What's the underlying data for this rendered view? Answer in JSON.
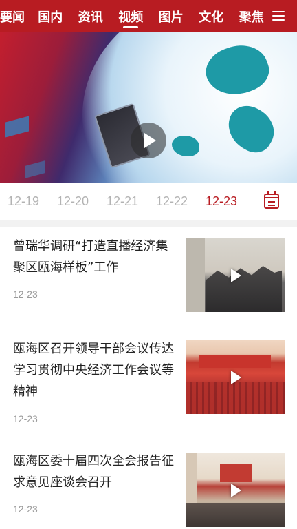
{
  "nav": {
    "tabs": [
      "要闻",
      "国内",
      "资讯",
      "视频",
      "图片",
      "文化",
      "聚焦"
    ],
    "active_index": 3,
    "menu_icon": "hamburger-menu-icon"
  },
  "hero": {
    "play_icon": "play-icon"
  },
  "dates": {
    "items": [
      "12-19",
      "12-20",
      "12-21",
      "12-22",
      "12-23"
    ],
    "active_index": 4,
    "calendar_icon": "calendar-icon"
  },
  "news": [
    {
      "title": "曾瑞华调研“打造直播经济集聚区瓯海样板”工作",
      "date": "12-23"
    },
    {
      "title": "瓯海区召开领导干部会议传达学习贯彻中央经济工作会议等精神",
      "date": "12-23"
    },
    {
      "title": "瓯海区委十届四次全会报告征求意见座谈会召开",
      "date": "12-23"
    }
  ],
  "colors": {
    "brand_red": "#b81c22",
    "inactive_date": "#b3b3b3",
    "title_text": "#222222",
    "meta_text": "#9a9a9a"
  }
}
